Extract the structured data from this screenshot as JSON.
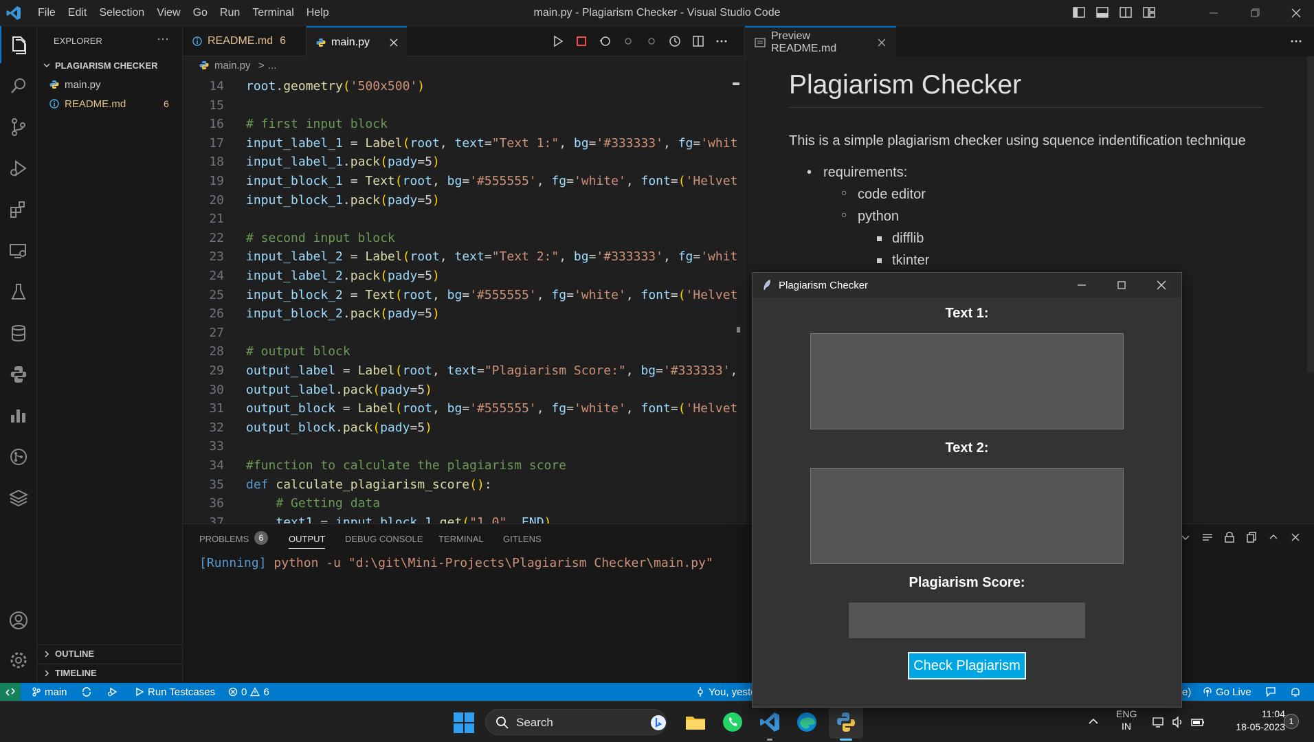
{
  "titlebar": {
    "menu": [
      "File",
      "Edit",
      "Selection",
      "View",
      "Go",
      "Run",
      "Terminal",
      "Help"
    ],
    "title": "main.py - Plagiarism Checker - Visual Studio Code"
  },
  "explorer": {
    "header": "EXPLORER",
    "more": "···",
    "folder": "PLAGIARISM CHECKER",
    "files": [
      {
        "name": "main.py",
        "badge": ""
      },
      {
        "name": "README.md",
        "badge": "6"
      }
    ],
    "outline": "OUTLINE",
    "timeline": "TIMELINE"
  },
  "tabs": [
    {
      "label": "README.md",
      "badge": "6"
    },
    {
      "label": "main.py",
      "badge": ""
    }
  ],
  "breadcrumb": {
    "file": "main.py",
    "sep": ">",
    "rest": "..."
  },
  "editor": {
    "lines": [
      {
        "n": "14",
        "parts": [
          [
            "id",
            "root"
          ],
          [
            "pl",
            "."
          ],
          [
            "fn",
            "geometry"
          ],
          [
            "br",
            "("
          ],
          [
            "st",
            "'500x500'"
          ],
          [
            "br",
            ")"
          ]
        ]
      },
      {
        "n": "15",
        "parts": []
      },
      {
        "n": "16",
        "parts": [
          [
            "cm",
            "# first input block"
          ]
        ]
      },
      {
        "n": "17",
        "parts": [
          [
            "id",
            "input_label_1"
          ],
          [
            "pl",
            " = "
          ],
          [
            "fn",
            "Label"
          ],
          [
            "br",
            "("
          ],
          [
            "id",
            "root"
          ],
          [
            "pl",
            ", "
          ],
          [
            "id",
            "text"
          ],
          [
            "pl",
            "="
          ],
          [
            "st",
            "\"Text 1:\""
          ],
          [
            "pl",
            ", "
          ],
          [
            "id",
            "bg"
          ],
          [
            "pl",
            "="
          ],
          [
            "st",
            "'#333333'"
          ],
          [
            "pl",
            ", "
          ],
          [
            "id",
            "fg"
          ],
          [
            "pl",
            "="
          ],
          [
            "st",
            "'whit"
          ]
        ]
      },
      {
        "n": "18",
        "parts": [
          [
            "id",
            "input_label_1"
          ],
          [
            "pl",
            "."
          ],
          [
            "fn",
            "pack"
          ],
          [
            "br",
            "("
          ],
          [
            "id",
            "pady"
          ],
          [
            "pl",
            "="
          ],
          [
            "pl",
            "5"
          ],
          [
            "br",
            ")"
          ]
        ]
      },
      {
        "n": "19",
        "parts": [
          [
            "id",
            "input_block_1"
          ],
          [
            "pl",
            " = "
          ],
          [
            "fn",
            "Text"
          ],
          [
            "br",
            "("
          ],
          [
            "id",
            "root"
          ],
          [
            "pl",
            ", "
          ],
          [
            "id",
            "bg"
          ],
          [
            "pl",
            "="
          ],
          [
            "st",
            "'#555555'"
          ],
          [
            "pl",
            ", "
          ],
          [
            "id",
            "fg"
          ],
          [
            "pl",
            "="
          ],
          [
            "st",
            "'white'"
          ],
          [
            "pl",
            ", "
          ],
          [
            "id",
            "font"
          ],
          [
            "pl",
            "="
          ],
          [
            "br",
            "("
          ],
          [
            "st",
            "'Helvet"
          ]
        ]
      },
      {
        "n": "20",
        "parts": [
          [
            "id",
            "input_block_1"
          ],
          [
            "pl",
            "."
          ],
          [
            "fn",
            "pack"
          ],
          [
            "br",
            "("
          ],
          [
            "id",
            "pady"
          ],
          [
            "pl",
            "="
          ],
          [
            "pl",
            "5"
          ],
          [
            "br",
            ")"
          ]
        ]
      },
      {
        "n": "21",
        "parts": []
      },
      {
        "n": "22",
        "parts": [
          [
            "cm",
            "# second input block"
          ]
        ]
      },
      {
        "n": "23",
        "parts": [
          [
            "id",
            "input_label_2"
          ],
          [
            "pl",
            " = "
          ],
          [
            "fn",
            "Label"
          ],
          [
            "br",
            "("
          ],
          [
            "id",
            "root"
          ],
          [
            "pl",
            ", "
          ],
          [
            "id",
            "text"
          ],
          [
            "pl",
            "="
          ],
          [
            "st",
            "\"Text 2:\""
          ],
          [
            "pl",
            ", "
          ],
          [
            "id",
            "bg"
          ],
          [
            "pl",
            "="
          ],
          [
            "st",
            "'#333333'"
          ],
          [
            "pl",
            ", "
          ],
          [
            "id",
            "fg"
          ],
          [
            "pl",
            "="
          ],
          [
            "st",
            "'whit"
          ]
        ]
      },
      {
        "n": "24",
        "parts": [
          [
            "id",
            "input_label_2"
          ],
          [
            "pl",
            "."
          ],
          [
            "fn",
            "pack"
          ],
          [
            "br",
            "("
          ],
          [
            "id",
            "pady"
          ],
          [
            "pl",
            "="
          ],
          [
            "pl",
            "5"
          ],
          [
            "br",
            ")"
          ]
        ]
      },
      {
        "n": "25",
        "parts": [
          [
            "id",
            "input_block_2"
          ],
          [
            "pl",
            " = "
          ],
          [
            "fn",
            "Text"
          ],
          [
            "br",
            "("
          ],
          [
            "id",
            "root"
          ],
          [
            "pl",
            ", "
          ],
          [
            "id",
            "bg"
          ],
          [
            "pl",
            "="
          ],
          [
            "st",
            "'#555555'"
          ],
          [
            "pl",
            ", "
          ],
          [
            "id",
            "fg"
          ],
          [
            "pl",
            "="
          ],
          [
            "st",
            "'white'"
          ],
          [
            "pl",
            ", "
          ],
          [
            "id",
            "font"
          ],
          [
            "pl",
            "="
          ],
          [
            "br",
            "("
          ],
          [
            "st",
            "'Helvet"
          ]
        ]
      },
      {
        "n": "26",
        "parts": [
          [
            "id",
            "input_block_2"
          ],
          [
            "pl",
            "."
          ],
          [
            "fn",
            "pack"
          ],
          [
            "br",
            "("
          ],
          [
            "id",
            "pady"
          ],
          [
            "pl",
            "="
          ],
          [
            "pl",
            "5"
          ],
          [
            "br",
            ")"
          ]
        ]
      },
      {
        "n": "27",
        "parts": []
      },
      {
        "n": "28",
        "parts": [
          [
            "cm",
            "# output block"
          ]
        ]
      },
      {
        "n": "29",
        "parts": [
          [
            "id",
            "output_label"
          ],
          [
            "pl",
            " = "
          ],
          [
            "fn",
            "Label"
          ],
          [
            "br",
            "("
          ],
          [
            "id",
            "root"
          ],
          [
            "pl",
            ", "
          ],
          [
            "id",
            "text"
          ],
          [
            "pl",
            "="
          ],
          [
            "st",
            "\"Plagiarism Score:\""
          ],
          [
            "pl",
            ", "
          ],
          [
            "id",
            "bg"
          ],
          [
            "pl",
            "="
          ],
          [
            "st",
            "'#333333'"
          ],
          [
            "pl",
            ","
          ]
        ]
      },
      {
        "n": "30",
        "parts": [
          [
            "id",
            "output_label"
          ],
          [
            "pl",
            "."
          ],
          [
            "fn",
            "pack"
          ],
          [
            "br",
            "("
          ],
          [
            "id",
            "pady"
          ],
          [
            "pl",
            "="
          ],
          [
            "pl",
            "5"
          ],
          [
            "br",
            ")"
          ]
        ]
      },
      {
        "n": "31",
        "parts": [
          [
            "id",
            "output_block"
          ],
          [
            "pl",
            " = "
          ],
          [
            "fn",
            "Label"
          ],
          [
            "br",
            "("
          ],
          [
            "id",
            "root"
          ],
          [
            "pl",
            ", "
          ],
          [
            "id",
            "bg"
          ],
          [
            "pl",
            "="
          ],
          [
            "st",
            "'#555555'"
          ],
          [
            "pl",
            ", "
          ],
          [
            "id",
            "fg"
          ],
          [
            "pl",
            "="
          ],
          [
            "st",
            "'white'"
          ],
          [
            "pl",
            ", "
          ],
          [
            "id",
            "font"
          ],
          [
            "pl",
            "="
          ],
          [
            "br",
            "("
          ],
          [
            "st",
            "'Helvet"
          ]
        ]
      },
      {
        "n": "32",
        "parts": [
          [
            "id",
            "output_block"
          ],
          [
            "pl",
            "."
          ],
          [
            "fn",
            "pack"
          ],
          [
            "br",
            "("
          ],
          [
            "id",
            "pady"
          ],
          [
            "pl",
            "="
          ],
          [
            "pl",
            "5"
          ],
          [
            "br",
            ")"
          ]
        ]
      },
      {
        "n": "33",
        "parts": []
      },
      {
        "n": "34",
        "parts": [
          [
            "cm",
            "#function to calculate the plagiarism score"
          ]
        ]
      },
      {
        "n": "35",
        "parts": [
          [
            "kw",
            "def "
          ],
          [
            "fn",
            "calculate_plagiarism_score"
          ],
          [
            "br",
            "()"
          ],
          [
            "pl",
            ":"
          ]
        ]
      },
      {
        "n": "36",
        "parts": [
          [
            "pl",
            "    "
          ],
          [
            "cm",
            "# Getting data"
          ]
        ]
      },
      {
        "n": "37",
        "parts": [
          [
            "pl",
            "    "
          ],
          [
            "id",
            "text1"
          ],
          [
            "pl",
            " = "
          ],
          [
            "id",
            "input_block_1"
          ],
          [
            "pl",
            "."
          ],
          [
            "fn",
            "get"
          ],
          [
            "br",
            "("
          ],
          [
            "st",
            "\"1.0\""
          ],
          [
            "pl",
            ", "
          ],
          [
            "id",
            "END"
          ],
          [
            "br",
            ")"
          ]
        ]
      }
    ]
  },
  "preview": {
    "tab": "Preview README.md",
    "heading": "Plagiarism Checker",
    "paragraph": "This is a simple plagiarism checker using squence indentification technique",
    "list": {
      "item": "requirements:",
      "sub": [
        "code editor",
        "python"
      ],
      "subsub": [
        "difflib",
        "tkinter"
      ]
    }
  },
  "panel": {
    "tabs": [
      "PROBLEMS",
      "OUTPUT",
      "DEBUG CONSOLE",
      "TERMINAL",
      "GITLENS"
    ],
    "problems_count": "6",
    "output_prefix": "[Running]",
    "output_cmd": " python -u \"d:\\git\\Mini-Projects\\Plagiarism Checker\\main.py\""
  },
  "status": {
    "branch": "main",
    "run": "Run Testcases",
    "errors": "0",
    "warnings": "6",
    "blame": "You, yeste",
    "right_fragment": "e)",
    "golive": "Go Live"
  },
  "taskbar": {
    "search": "Search",
    "lang1": "ENG",
    "lang2": "IN",
    "time": "11:04",
    "date": "18-05-2023",
    "notif": "1"
  },
  "tk": {
    "title": "Plagiarism Checker",
    "label1": "Text 1:",
    "label2": "Text 2:",
    "label3": "Plagiarism Score:",
    "button": "Check Plagiarism"
  },
  "colors": {
    "accent": "#007acc",
    "tk_button": "#00a6e3",
    "tk_bg": "#333333",
    "tk_box": "#555555"
  }
}
